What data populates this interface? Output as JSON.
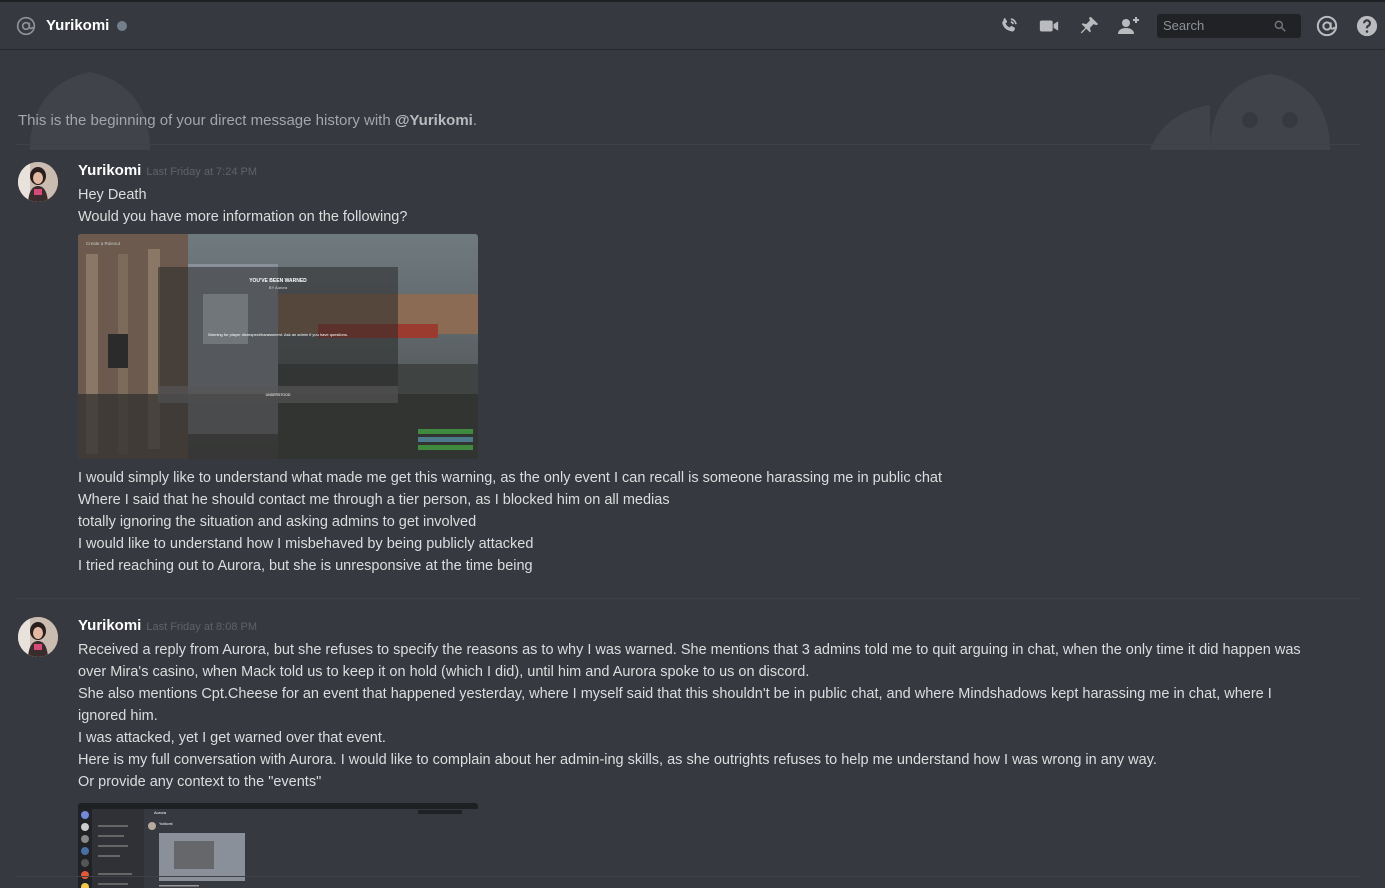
{
  "header": {
    "channel_name": "Yurikomi",
    "search_placeholder": "Search"
  },
  "intro": {
    "prefix": "This is the beginning of your direct message history with ",
    "mention": "@Yurikomi",
    "suffix": "."
  },
  "messages": [
    {
      "author": "Yurikomi",
      "timestamp": "Last Friday at 7:24 PM",
      "lines_before": [
        "Hey Death",
        "Would you have more information on the following?"
      ],
      "attachment": {
        "title": "YOU'VE BEEN WARNED",
        "subtitle": "BY Aurora",
        "body": "Warning for player disrespect/harassment. Ask an admin if you have questions.",
        "button": "UNDERSTOOD",
        "corner_label": "Create a Ruleout"
      },
      "lines_after": [
        "I would simply like to understand what made me get this warning, as the only event I can recall is someone harassing me in public chat",
        "Where I said that he should contact me through a tier person, as I blocked him on all medias",
        "totally ignoring the situation and asking admins to get involved",
        "I would like to understand how I misbehaved by being publicly attacked",
        "I tried reaching out to Aurora, but she is unresponsive at the time being"
      ]
    },
    {
      "author": "Yurikomi",
      "timestamp": "Last Friday at 8:08 PM",
      "lines": [
        "Received a reply from Aurora, but she refuses to specify the reasons as to why I was warned. She mentions that 3 admins told me to quit arguing in chat, when the only time it did happen was over Mira's casino, when Mack told us to keep it on hold (which I did), until him and Aurora spoke to us on discord.",
        "She also mentions Cpt.Cheese for an event that happened yesterday, where I myself said that this shouldn't be in public chat, and where Mindshadows kept harassing me in chat, where I ignored him.",
        "I was attacked, yet I get warned over that event.",
        "Here is my full conversation with Aurora. I would like to complain about her admin-ing skills, as she outrights refuses to help me understand how I was wrong in any way.",
        "Or provide any context to the \"events\""
      ],
      "attachment": {
        "mini_title": "Aurora",
        "mini_author": "Yurikomi"
      }
    }
  ]
}
